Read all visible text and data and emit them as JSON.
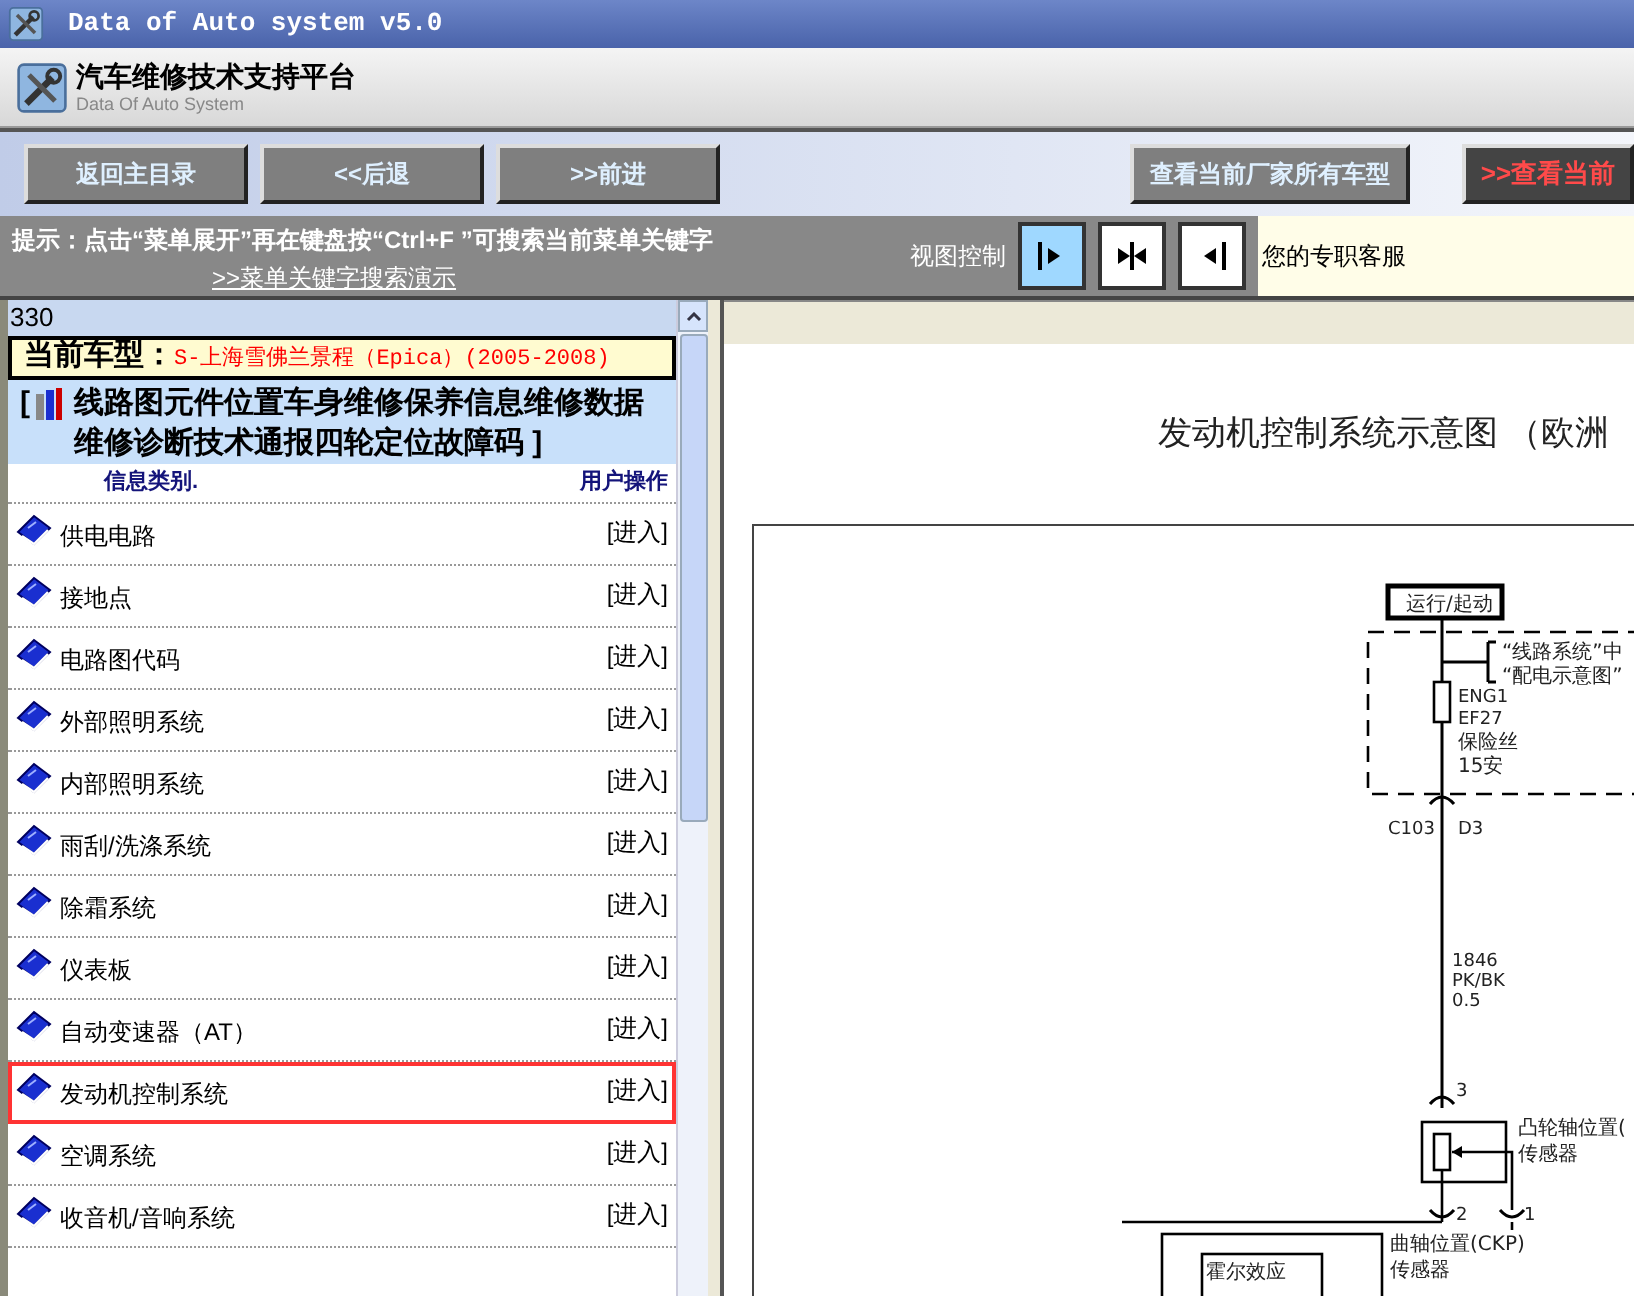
{
  "window": {
    "title": "Data of Auto system v5.0"
  },
  "header": {
    "title": "汽车维修技术支持平台",
    "subtitle": "Data Of Auto System"
  },
  "toolbar": {
    "buttons": [
      {
        "label": "返回主目录",
        "kind": "nav"
      },
      {
        "label": "<<后退",
        "kind": "nav"
      },
      {
        "label": ">>前进",
        "kind": "nav"
      },
      {
        "label": "查看当前厂家所有车型",
        "kind": "secondary"
      },
      {
        "label": ">>查看当前",
        "kind": "alert"
      }
    ]
  },
  "hint": {
    "text": "提示：点击“菜单展开”再在键盘按“Ctrl+F ”可搜索当前菜单关键字",
    "link": ">>菜单关键字搜索演示"
  },
  "view_control": {
    "label": "视图控制",
    "buttons": [
      {
        "kind": "right",
        "selected": true
      },
      {
        "kind": "split",
        "selected": false
      },
      {
        "kind": "left",
        "selected": false
      }
    ]
  },
  "service": {
    "text": "您的专职客服"
  },
  "left_panel": {
    "count": "330",
    "car_model": {
      "label": "当前车型：",
      "value": "S-上海雪佛兰景程（Epica）(2005-2008)"
    },
    "categories": {
      "open": "[",
      "text": "线路图元件位置车身维修保养信息维修数据维修诊断技术通报四轮定位故障码 ]"
    },
    "columns": [
      "信息类别.",
      "用户操作"
    ],
    "items": [
      {
        "label": "供电电路",
        "action": "[进入]",
        "selected": false
      },
      {
        "label": "接地点",
        "action": "[进入]",
        "selected": false
      },
      {
        "label": "电路图代码",
        "action": "[进入]",
        "selected": false
      },
      {
        "label": "外部照明系统",
        "action": "[进入]",
        "selected": false
      },
      {
        "label": "内部照明系统",
        "action": "[进入]",
        "selected": false
      },
      {
        "label": "雨刮/洗涤系统",
        "action": "[进入]",
        "selected": false
      },
      {
        "label": "除霜系统",
        "action": "[进入]",
        "selected": false
      },
      {
        "label": "仪表板",
        "action": "[进入]",
        "selected": false
      },
      {
        "label": "自动变速器（AT）",
        "action": "[进入]",
        "selected": false
      },
      {
        "label": "发动机控制系统",
        "action": "[进入]",
        "selected": true
      },
      {
        "label": "空调系统",
        "action": "[进入]",
        "selected": false
      },
      {
        "label": "收音机/音响系统",
        "action": "[进入]",
        "selected": false
      }
    ]
  },
  "content": {
    "title": "发动机控制系统示意图 （欧洲",
    "diagram": {
      "labels": [
        "运行/起动",
        "“线路系统”中",
        "“配电示意图”",
        "ENG1",
        "EF27",
        "保险丝",
        "15安",
        "C103",
        "D3",
        "1846",
        "PK/BK",
        "0.5",
        "3",
        "凸轮轴位置(",
        "传感器",
        "2",
        "1",
        "曲轴位置(CKP)",
        "传感器",
        "霍尔效应"
      ]
    }
  }
}
